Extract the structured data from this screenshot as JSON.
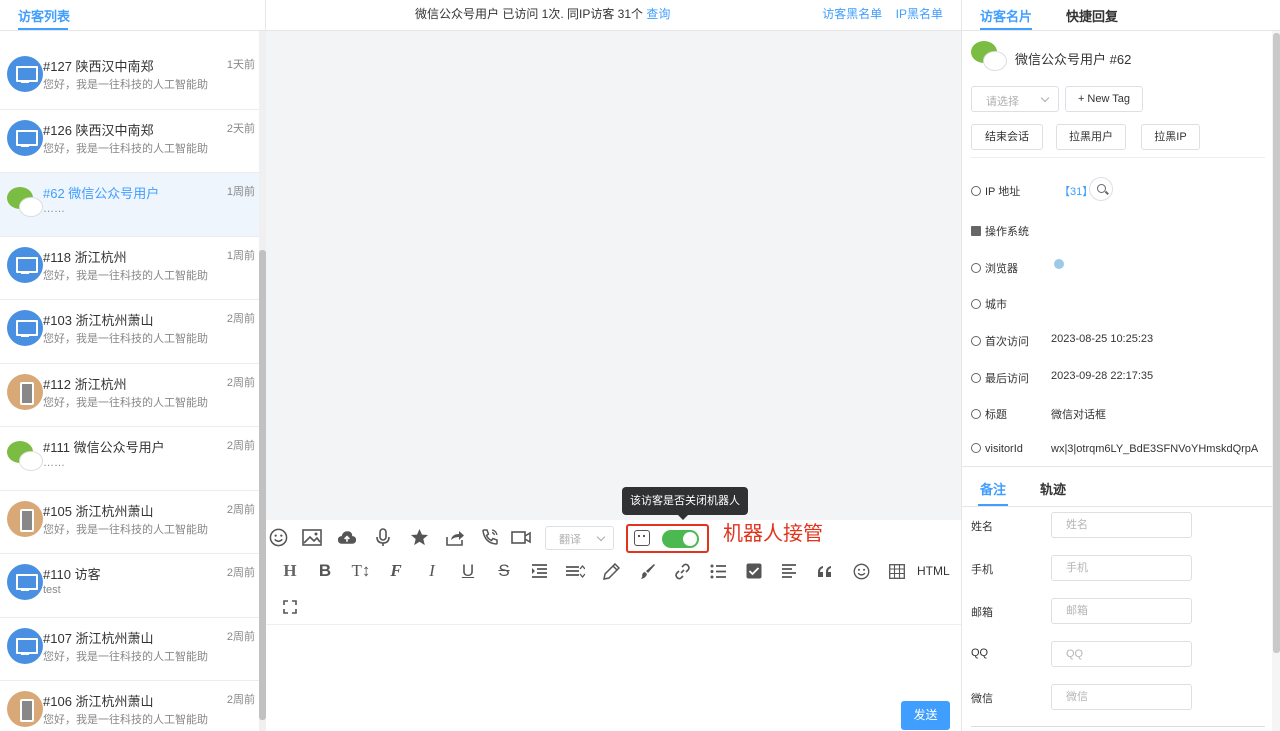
{
  "left": {
    "tab": "访客列表",
    "visitors": [
      {
        "name": "#127 陕西汉中南郑",
        "msg": "您好，我是一往科技的人工智能助",
        "time": "1天前",
        "avatar": "pc"
      },
      {
        "name": "#126 陕西汉中南郑",
        "msg": "您好，我是一往科技的人工智能助",
        "time": "2天前",
        "avatar": "pc"
      },
      {
        "name": "#62 微信公众号用户",
        "msg": "……",
        "time": "1周前",
        "avatar": "wx",
        "active": true
      },
      {
        "name": "#118 浙江杭州",
        "msg": "您好，我是一往科技的人工智能助",
        "time": "1周前",
        "avatar": "pc"
      },
      {
        "name": "#103 浙江杭州萧山",
        "msg": "您好，我是一往科技的人工智能助",
        "time": "2周前",
        "avatar": "pc"
      },
      {
        "name": "#112 浙江杭州",
        "msg": "您好，我是一往科技的人工智能助",
        "time": "2周前",
        "avatar": "phone"
      },
      {
        "name": "#111 微信公众号用户",
        "msg": "……",
        "time": "2周前",
        "avatar": "wx"
      },
      {
        "name": "#105 浙江杭州萧山",
        "msg": "您好，我是一往科技的人工智能助",
        "time": "2周前",
        "avatar": "phone"
      },
      {
        "name": "#110 访客",
        "msg": "test",
        "time": "2周前",
        "avatar": "pc"
      },
      {
        "name": "#107 浙江杭州萧山",
        "msg": "您好，我是一往科技的人工智能助",
        "time": "2周前",
        "avatar": "pc"
      },
      {
        "name": "#106 浙江杭州萧山",
        "msg": "您好，我是一往科技的人工智能助",
        "time": "2周前",
        "avatar": "phone"
      }
    ]
  },
  "header": {
    "info": "微信公众号用户  已访问 1次.  同IP访客   31个 ",
    "query_link": "查询",
    "visitor_blacklist": "访客黑名单",
    "ip_blacklist": "IP黑名单"
  },
  "toolbar": {
    "translate_placeholder": "翻译",
    "tooltip": "该访客是否关闭机器人",
    "robot_annotation": "机器人接管",
    "html_label": "HTML",
    "icons": [
      "emoji-icon",
      "image-icon",
      "upload-cloud-icon",
      "microphone-icon",
      "star-icon",
      "share-icon",
      "phone-call-icon",
      "video-icon"
    ],
    "format_icons": [
      "heading-icon",
      "bold-icon",
      "font-size-icon",
      "font-family-icon",
      "italic-icon",
      "underline-icon",
      "strikethrough-icon",
      "indent-icon",
      "line-height-icon",
      "font-color-icon",
      "background-color-icon",
      "link-icon",
      "list-icon",
      "checkbox-icon",
      "align-icon",
      "quote-icon",
      "emoticon-icon",
      "table-icon"
    ],
    "robot_toggle_on": true
  },
  "input": {
    "send": "发送"
  },
  "right": {
    "tabs": [
      "访客名片",
      "快捷回复"
    ],
    "visitor_name": "微信公众号用户  #62",
    "select_placeholder": "请选择",
    "new_tag": "+ New Tag",
    "buttons": [
      "结束会话",
      "拉黑用户",
      "拉黑IP"
    ],
    "info": [
      {
        "label": "IP 地址",
        "value": "【31】"
      },
      {
        "label": "操作系统",
        "value": ""
      },
      {
        "label": "浏览器",
        "value": ""
      },
      {
        "label": "城市",
        "value": ""
      },
      {
        "label": "首次访问",
        "value": "2023-08-25 10:25:23"
      },
      {
        "label": "最后访问",
        "value": "2023-09-28 22:17:35"
      },
      {
        "label": "标题",
        "value": "微信对话框"
      },
      {
        "label": "visitorId",
        "value": "wx|3|otrqm6LY_BdE3SFNVoYHmskdQrpA"
      }
    ],
    "tabs2": [
      "备注",
      "轨迹"
    ],
    "form": [
      {
        "label": "姓名",
        "placeholder": "姓名"
      },
      {
        "label": "手机",
        "placeholder": "手机"
      },
      {
        "label": "邮箱",
        "placeholder": "邮箱"
      },
      {
        "label": "QQ",
        "placeholder": "QQ"
      },
      {
        "label": "微信",
        "placeholder": "微信"
      }
    ]
  },
  "colors": {
    "accent": "#409eff",
    "toggle_on": "#4cb950",
    "annotation_red": "#e1331d"
  }
}
